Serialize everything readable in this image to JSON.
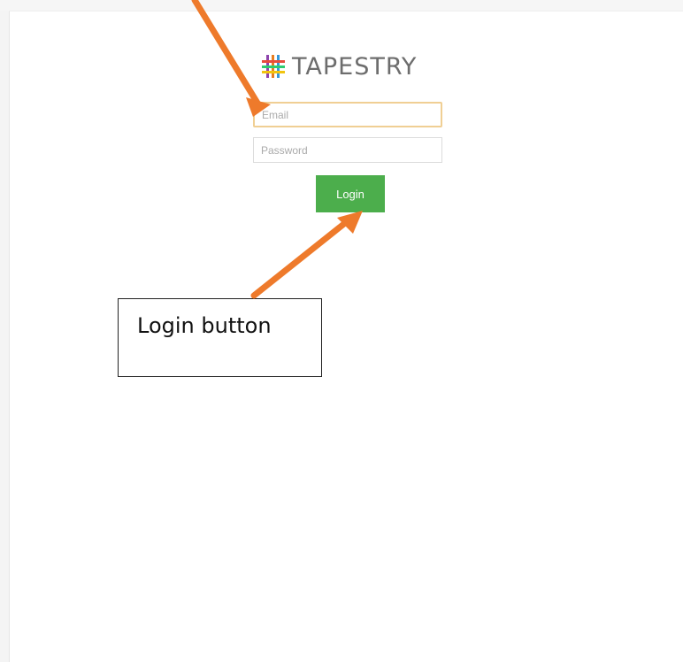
{
  "logo": {
    "text": "TAPESTRY",
    "icon": "tapestry-hash-icon",
    "icon_colors": [
      "#8e44ad",
      "#e67e22",
      "#3498db",
      "#e74c3c",
      "#2ecc71",
      "#f1c40f"
    ]
  },
  "form": {
    "email_placeholder": "Email",
    "password_placeholder": "Password",
    "login_label": "Login"
  },
  "annotation": {
    "label": "Login button",
    "arrow_color": "#ee7a2b"
  },
  "colors": {
    "login_button": "#4cae4c",
    "email_focus_border": "#f0cf94"
  }
}
